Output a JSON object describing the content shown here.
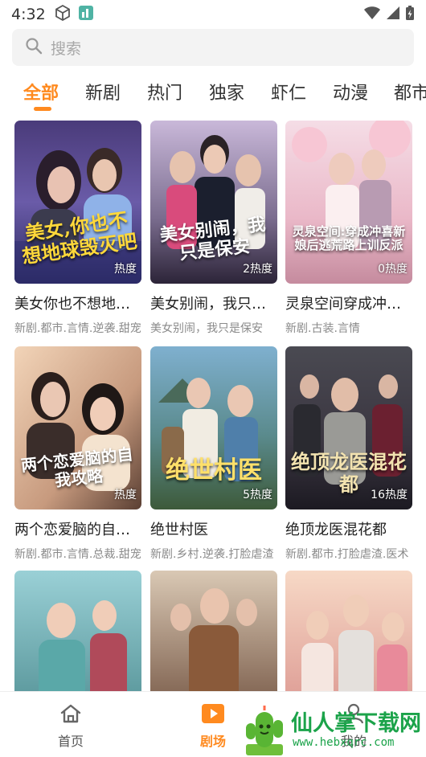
{
  "status_bar": {
    "time": "4:32",
    "icons": [
      "cube-icon",
      "app-notification-icon",
      "wifi-icon",
      "signal-icon",
      "battery-charging-icon"
    ]
  },
  "search": {
    "placeholder": "搜索"
  },
  "tabs": [
    {
      "label": "全部",
      "active": true
    },
    {
      "label": "新剧",
      "active": false
    },
    {
      "label": "热门",
      "active": false
    },
    {
      "label": "独家",
      "active": false
    },
    {
      "label": "虾仁",
      "active": false
    },
    {
      "label": "动漫",
      "active": false
    },
    {
      "label": "都市",
      "active": false
    }
  ],
  "cards": [
    {
      "title": "美女你也不想地球毁灭吧",
      "tags": "新剧.都市.言情.逆袭.甜宠",
      "heat": "热度",
      "poster_text": "美女,你也不想地球毁灭吧"
    },
    {
      "title": "美女别闹，我只是保安",
      "tags": "美女别闹，我只是保安",
      "heat": "2热度",
      "poster_text": "美女别闹，我只是保安"
    },
    {
      "title": "灵泉空间穿成冲喜新娘后",
      "tags": "新剧.古装.言情",
      "heat": "0热度",
      "poster_text": "灵泉空间:穿成冲喜新娘后逃荒路上训反派"
    },
    {
      "title": "两个恋爱脑的自我攻略",
      "tags": "新剧.都市.言情.总裁.甜宠",
      "heat": "热度",
      "poster_text": "两个恋爱脑的自我攻略"
    },
    {
      "title": "绝世村医",
      "tags": "新剧.乡村.逆袭.打脸虐渣",
      "heat": "5热度",
      "poster_text": "绝世村医"
    },
    {
      "title": "绝顶龙医混花都",
      "tags": "新剧.都市.打脸虐渣.医术",
      "heat": "16热度",
      "poster_text": "绝顶龙医混花都"
    },
    {
      "title": "",
      "tags": "",
      "heat": "",
      "poster_text": ""
    },
    {
      "title": "",
      "tags": "",
      "heat": "",
      "poster_text": ""
    },
    {
      "title": "",
      "tags": "",
      "heat": "",
      "poster_text": ""
    }
  ],
  "bottom_nav": [
    {
      "label": "首页",
      "icon": "home-icon",
      "active": false
    },
    {
      "label": "剧场",
      "icon": "play-icon",
      "active": true
    },
    {
      "label": "我的",
      "icon": "profile-icon",
      "active": false
    }
  ],
  "watermark": {
    "title": "仙人掌下载网",
    "url": "www.hebxqrc.com"
  },
  "colors": {
    "accent": "#ff8a1f",
    "watermark_green": "#1ba34a"
  }
}
